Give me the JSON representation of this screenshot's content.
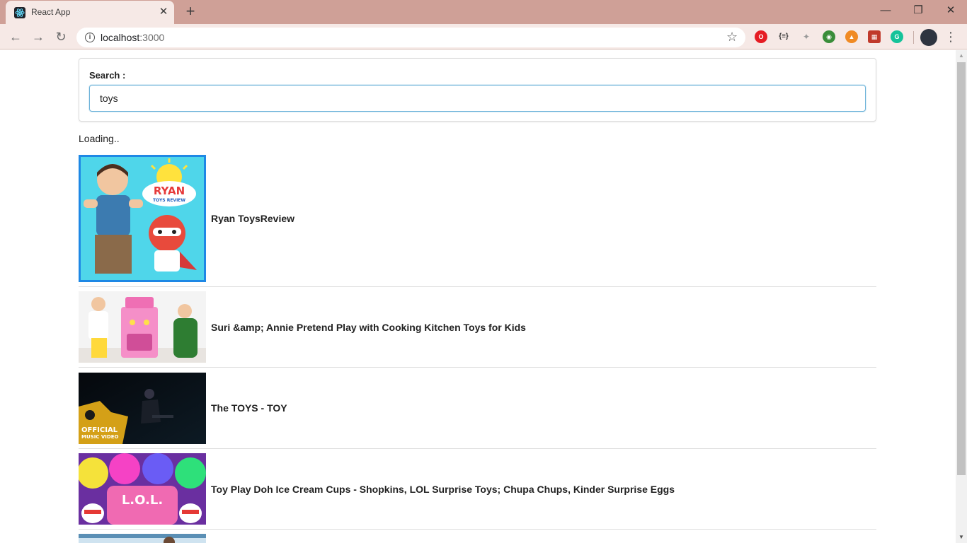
{
  "browser": {
    "tab_title": "React App",
    "url_host": "localhost",
    "url_port": ":3000",
    "window_controls": {
      "minimize": "—",
      "restore": "❐",
      "close": "✕"
    }
  },
  "search": {
    "label": "Search :",
    "value": "toys"
  },
  "status_text": "Loading..",
  "videos": [
    {
      "title": "Ryan ToysReview",
      "selected": true
    },
    {
      "title": "Suri &amp; Annie Pretend Play with Cooking Kitchen Toys for Kids",
      "selected": false
    },
    {
      "title": "The TOYS - TOY",
      "selected": false
    },
    {
      "title": "Toy Play Doh Ice Cream Cups - Shopkins, LOL Surprise Toys; Chupa Chups, Kinder Surprise Eggs",
      "selected": false
    }
  ],
  "thumbnail_text": {
    "ryan_logo": "RYAN",
    "ryan_sub": "TOYS REVIEW",
    "official": "OFFICIAL",
    "music_video": "MUSIC VIDEO",
    "lol": "L.O.L."
  },
  "colors": {
    "tabstrip": "#cfa097",
    "toolbar": "#f6e9e6",
    "selected_border": "#1e88e5",
    "input_focus": "#6cb2d9"
  }
}
